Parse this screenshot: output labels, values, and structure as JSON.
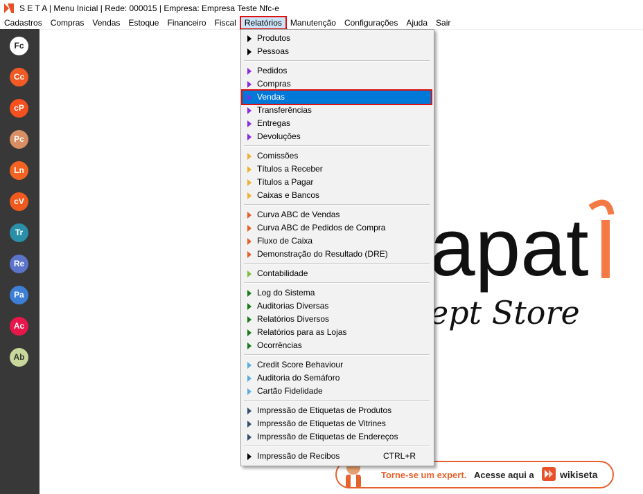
{
  "window": {
    "title": "S E T A | Menu Inicial | Rede: 000015 | Empresa: Empresa Teste Nfc-e"
  },
  "menubar": {
    "items": [
      "Cadastros",
      "Compras",
      "Vendas",
      "Estoque",
      "Financeiro",
      "Fiscal",
      "Relatórios",
      "Manutenção",
      "Configurações",
      "Ajuda",
      "Sair"
    ],
    "active": "Relatórios"
  },
  "sidebar": {
    "buttons": [
      {
        "label": "Fc",
        "color": "#ffffff",
        "text_color": "#222222"
      },
      {
        "label": "Cc",
        "color": "#f15a24"
      },
      {
        "label": "cP",
        "color": "#f5501e"
      },
      {
        "label": "Pc",
        "color": "#d98e63"
      },
      {
        "label": "Ln",
        "color": "#f26322"
      },
      {
        "label": "cV",
        "color": "#f15a1e"
      },
      {
        "label": "Tr",
        "color": "#2a8fa8"
      },
      {
        "label": "Re",
        "color": "#5b74c9"
      },
      {
        "label": "Pa",
        "color": "#3d7fd6"
      },
      {
        "label": "Ac",
        "color": "#e8174b"
      },
      {
        "label": "Ab",
        "color": "#c8d89a",
        "text_color": "#333333"
      }
    ]
  },
  "reports_menu": {
    "groups": [
      {
        "arrow_color": "#000000",
        "items": [
          "Produtos",
          "Pessoas"
        ]
      },
      {
        "arrow_color": "#8a2be2",
        "items": [
          "Pedidos",
          "Compras",
          "Vendas",
          "Transferências",
          "Entregas",
          "Devoluções"
        ]
      },
      {
        "arrow_color": "#f0b030",
        "items": [
          "Comissões",
          "Títulos a Receber",
          "Títulos a Pagar",
          "Caixas e Bancos"
        ]
      },
      {
        "arrow_color": "#e8602c",
        "items": [
          "Curva ABC de Vendas",
          "Curva ABC de Pedidos de Compra",
          "Fluxo de Caixa",
          "Demonstração do Resultado (DRE)"
        ]
      },
      {
        "arrow_color": "#7cbf3a",
        "items": [
          "Contabilidade"
        ]
      },
      {
        "arrow_color": "#1a7a1a",
        "items": [
          "Log do Sistema",
          "Auditorias Diversas",
          "Relatórios Diversos",
          "Relatórios para as Lojas",
          "Ocorrências"
        ]
      },
      {
        "arrow_color": "#5aaee0",
        "items": [
          "Credit Score Behaviour",
          "Auditoria do Semáforo",
          "Cartão Fidelidade"
        ]
      },
      {
        "arrow_color": "#2f4f6f",
        "items": [
          "Impressão de Etiquetas de Produtos",
          "Impressão de Etiquetas de Vitrines",
          "Impressão de Etiquetas de Endereços"
        ]
      },
      {
        "arrow_color": "#000000",
        "items": [
          "Impressão de Recibos"
        ],
        "shortcut": "CTRL+R"
      }
    ],
    "highlighted": "Vendas"
  },
  "background_logo": {
    "text": "apat",
    "subtitle": "ept Store"
  },
  "cta_banner": {
    "text_orange": "Torne-se um expert.",
    "text_dark": "Acesse aqui a",
    "brand": "wikiseta",
    "accent_color": "#e8602c"
  }
}
